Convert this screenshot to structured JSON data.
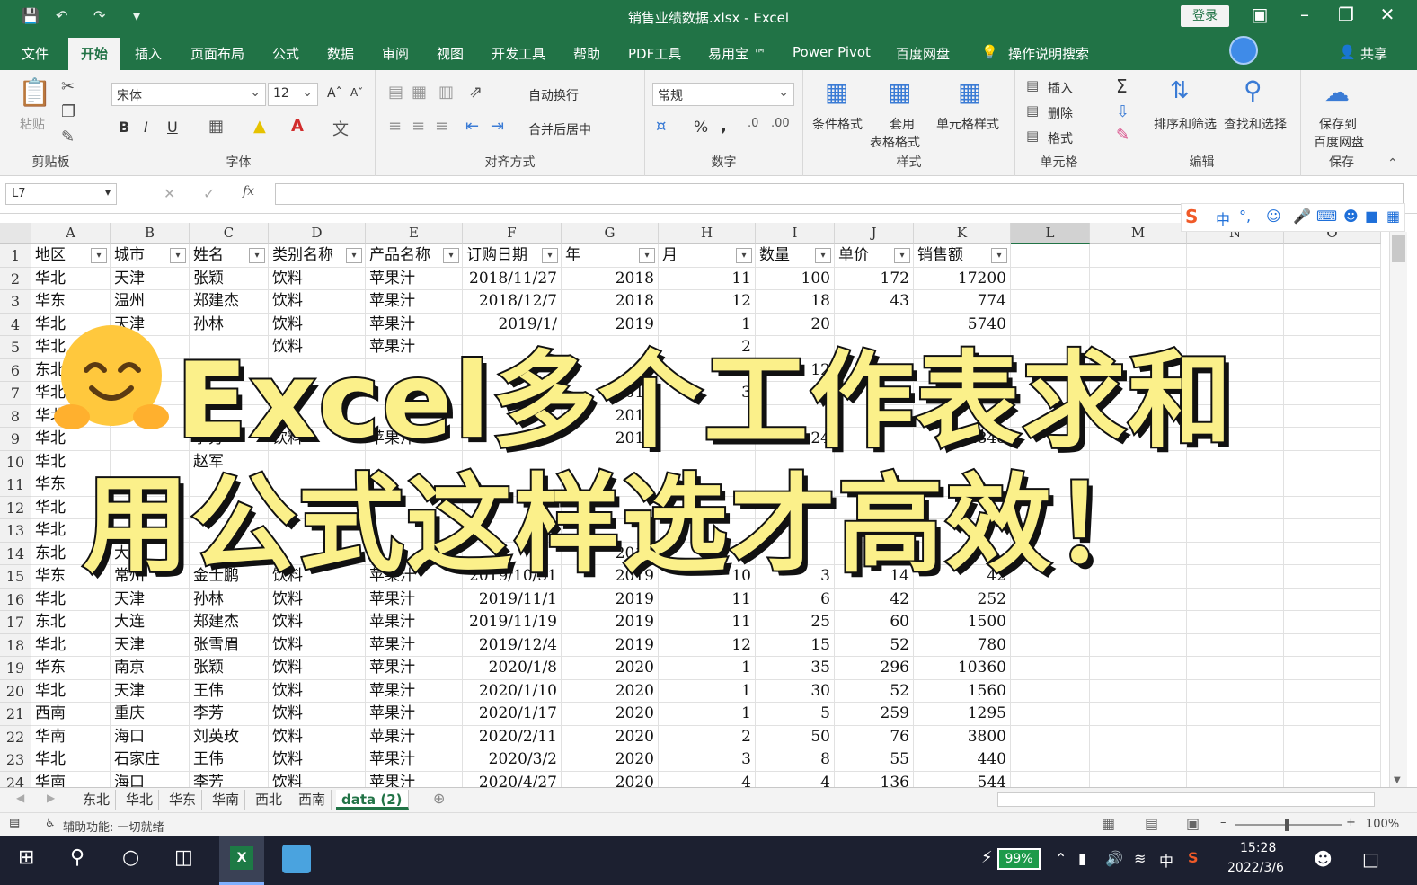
{
  "window": {
    "title": "销售业绩数据.xlsx  -  Excel",
    "login_label": "登录",
    "colors": {
      "brand": "#217346",
      "overlay_fill": "#fbf08a",
      "overlay_stroke": "#111111"
    }
  },
  "ribbon_tabs": [
    "文件",
    "开始",
    "插入",
    "页面布局",
    "公式",
    "数据",
    "审阅",
    "视图",
    "开发工具",
    "帮助",
    "PDF工具",
    "易用宝 ™",
    "Power Pivot",
    "百度网盘",
    "操作说明搜索"
  ],
  "share_label": "共享",
  "ribbon": {
    "clipboard": {
      "paste": "粘贴",
      "label": "剪贴板"
    },
    "font": {
      "name": "宋体",
      "size": "12",
      "label": "字体",
      "bold": "B",
      "italic": "I",
      "underline": "U"
    },
    "alignment": {
      "wrap": "自动换行",
      "merge": "合并后居中",
      "label": "对齐方式"
    },
    "number": {
      "format": "常规",
      "percent": "%",
      "comma": ",",
      "label": "数字"
    },
    "styles": {
      "conditional": "条件格式",
      "table_line1": "套用",
      "table_line2": "表格格式",
      "cell_styles": "单元格样式",
      "label": "样式"
    },
    "cells": {
      "insert": "插入",
      "delete": "删除",
      "format": "格式",
      "label": "单元格"
    },
    "editing": {
      "sum": "Σ",
      "sort": "排序和筛选",
      "find": "查找和选择",
      "label": "编辑"
    },
    "save": {
      "line1": "保存到",
      "line2": "百度网盘",
      "label": "保存"
    }
  },
  "formula_bar": {
    "name_box": "L7",
    "fx": "fx",
    "value": ""
  },
  "ime_toolbar": {
    "lang": "中"
  },
  "columns": [
    "A",
    "B",
    "C",
    "D",
    "E",
    "F",
    "G",
    "H",
    "I",
    "J",
    "K",
    "L",
    "M",
    "N",
    "O"
  ],
  "selected_column": "L",
  "headers": [
    "地区",
    "城市",
    "姓名",
    "类别名称",
    "产品名称",
    "订购日期",
    "年",
    "月",
    "数量",
    "单价",
    "销售额"
  ],
  "rows": [
    [
      "华北",
      "天津",
      "张颖",
      "饮料",
      "苹果汁",
      "2018/11/27",
      "2018",
      "11",
      "100",
      "172",
      "17200"
    ],
    [
      "华东",
      "温州",
      "郑建杰",
      "饮料",
      "苹果汁",
      "2018/12/7",
      "2018",
      "12",
      "18",
      "43",
      "774"
    ],
    [
      "华北",
      "天津",
      "孙林",
      "饮料",
      "苹果汁",
      "2019/1/",
      "2019",
      "1",
      "20",
      "",
      "5740"
    ],
    [
      "华北",
      "",
      "",
      "饮料",
      "苹果汁",
      "",
      "",
      "2",
      "",
      "",
      ""
    ],
    [
      "东北",
      "",
      "",
      "",
      "",
      "",
      "",
      "2",
      "12",
      "",
      ""
    ],
    [
      "华北",
      "",
      "",
      "",
      "",
      "",
      "2019",
      "3",
      "15",
      "",
      ""
    ],
    [
      "华北",
      "",
      "",
      "",
      "",
      "",
      "2019",
      "",
      "",
      "",
      ""
    ],
    [
      "华北",
      "",
      "李芳",
      "饮料",
      "苹果汁",
      "",
      "2019",
      "4",
      "24",
      "",
      "4848"
    ],
    [
      "华北",
      "",
      "赵军",
      "",
      "",
      "",
      "",
      "",
      "",
      "",
      ""
    ],
    [
      "华东",
      "",
      "",
      "",
      "",
      "",
      "",
      "",
      "",
      "",
      ""
    ],
    [
      "华北",
      "",
      "",
      "",
      "",
      "",
      "",
      "",
      "",
      "",
      ""
    ],
    [
      "华北",
      "",
      "",
      "",
      "",
      "",
      "",
      "",
      "",
      "",
      ""
    ],
    [
      "东北",
      "大",
      "",
      "",
      "",
      "",
      "2019",
      "",
      "",
      "",
      ""
    ],
    [
      "华东",
      "常州",
      "金士鹏",
      "饮料",
      "苹果汁",
      "2019/10/31",
      "2019",
      "10",
      "3",
      "14",
      "42"
    ],
    [
      "华北",
      "天津",
      "孙林",
      "饮料",
      "苹果汁",
      "2019/11/1",
      "2019",
      "11",
      "6",
      "42",
      "252"
    ],
    [
      "东北",
      "大连",
      "郑建杰",
      "饮料",
      "苹果汁",
      "2019/11/19",
      "2019",
      "11",
      "25",
      "60",
      "1500"
    ],
    [
      "华北",
      "天津",
      "张雪眉",
      "饮料",
      "苹果汁",
      "2019/12/4",
      "2019",
      "12",
      "15",
      "52",
      "780"
    ],
    [
      "华东",
      "南京",
      "张颖",
      "饮料",
      "苹果汁",
      "2020/1/8",
      "2020",
      "1",
      "35",
      "296",
      "10360"
    ],
    [
      "华北",
      "天津",
      "王伟",
      "饮料",
      "苹果汁",
      "2020/1/10",
      "2020",
      "1",
      "30",
      "52",
      "1560"
    ],
    [
      "西南",
      "重庆",
      "李芳",
      "饮料",
      "苹果汁",
      "2020/1/17",
      "2020",
      "1",
      "5",
      "259",
      "1295"
    ],
    [
      "华南",
      "海口",
      "刘英玫",
      "饮料",
      "苹果汁",
      "2020/2/11",
      "2020",
      "2",
      "50",
      "76",
      "3800"
    ],
    [
      "华北",
      "石家庄",
      "王伟",
      "饮料",
      "苹果汁",
      "2020/3/2",
      "2020",
      "3",
      "8",
      "55",
      "440"
    ],
    [
      "华南",
      "海口",
      "李芳",
      "饮料",
      "苹果汁",
      "2020/4/27",
      "2020",
      "4",
      "4",
      "136",
      "544"
    ]
  ],
  "overlay": {
    "line1": "Excel多个工作表求和",
    "line2": "用公式这样选才高效！"
  },
  "sheet_tabs": [
    "东北",
    "华北",
    "华东",
    "华南",
    "西北",
    "西南",
    "data (2)"
  ],
  "active_sheet": "data (2)",
  "status": {
    "accessibility": "辅助功能: 一切就绪",
    "zoom": "100%"
  },
  "taskbar": {
    "battery": "99%",
    "ime": "中",
    "time": "15:28",
    "date": "2022/3/6"
  }
}
